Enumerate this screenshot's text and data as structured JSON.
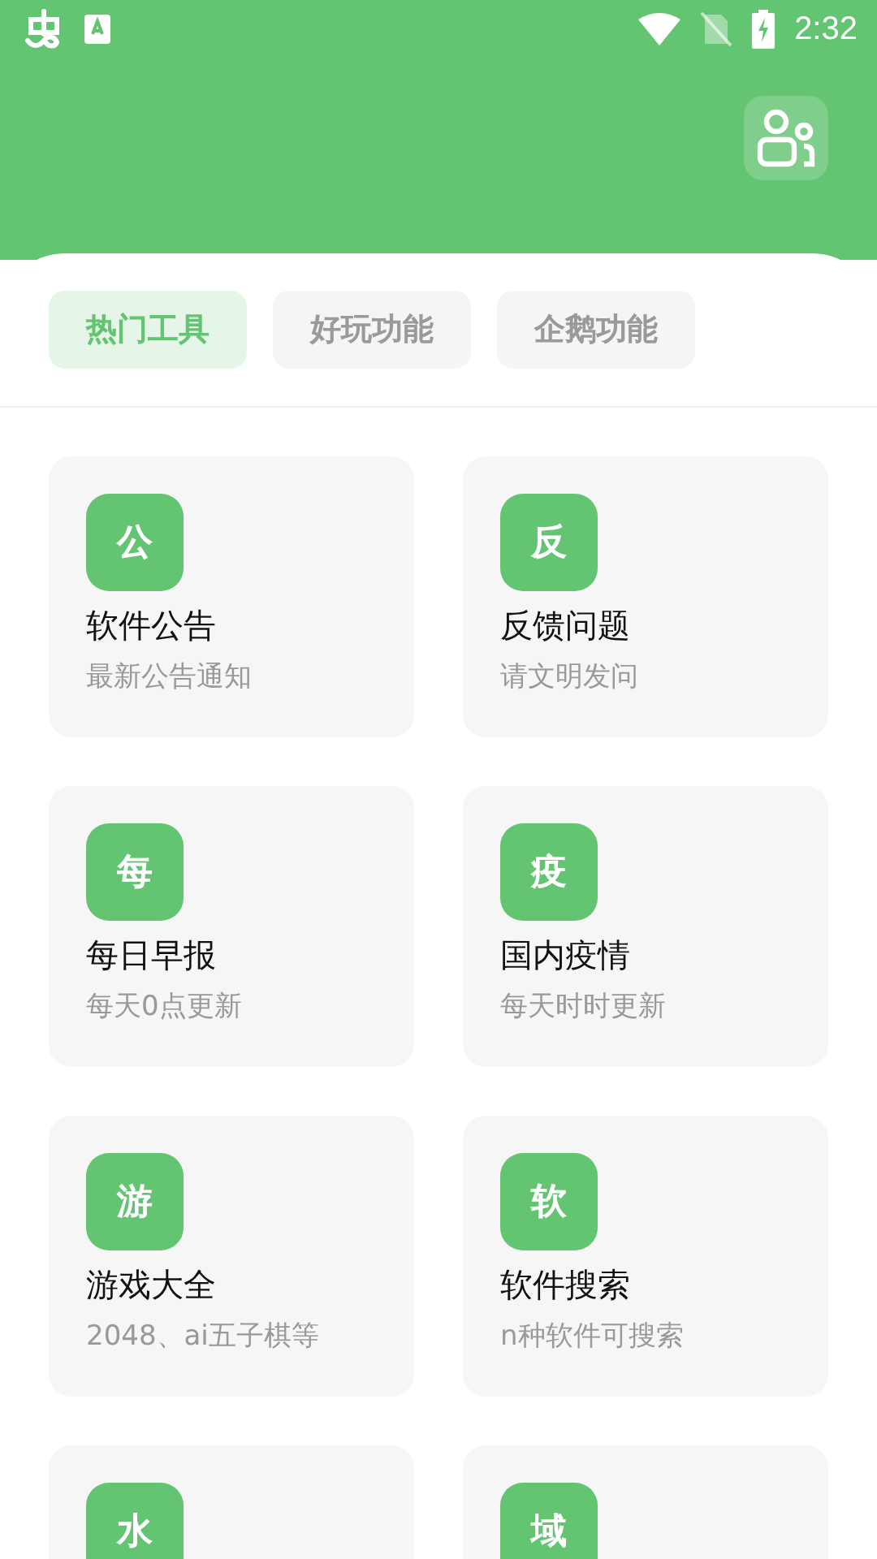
{
  "status_bar": {
    "time": "2:32"
  },
  "tabs": [
    {
      "label": "热门工具",
      "selected": true
    },
    {
      "label": "好玩功能",
      "selected": false
    },
    {
      "label": "企鹅功能",
      "selected": false
    }
  ],
  "tools": [
    {
      "icon": "公",
      "title": "软件公告",
      "subtitle": "最新公告通知"
    },
    {
      "icon": "反",
      "title": "反馈问题",
      "subtitle": "请文明发问"
    },
    {
      "icon": "每",
      "title": "每日早报",
      "subtitle": "每天0点更新"
    },
    {
      "icon": "疫",
      "title": "国内疫情",
      "subtitle": "每天时时更新"
    },
    {
      "icon": "游",
      "title": "游戏大全",
      "subtitle": "2048、ai五子棋等"
    },
    {
      "icon": "软",
      "title": "软件搜索",
      "subtitle": "n种软件可搜索"
    },
    {
      "icon": "水"
    },
    {
      "icon": "域"
    }
  ]
}
